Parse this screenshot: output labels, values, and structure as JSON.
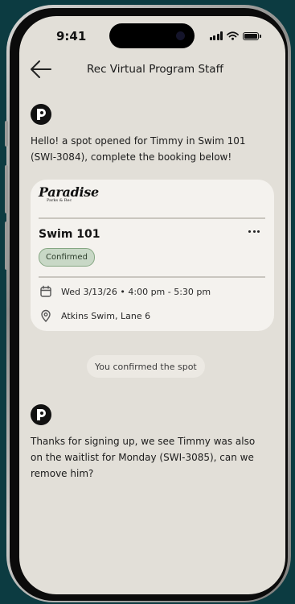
{
  "status_bar": {
    "time": "9:41"
  },
  "header": {
    "title": "Rec Virtual Program Staff"
  },
  "messages": [
    {
      "text": "Hello! a spot opened for Timmy in Swim 101 (SWI-3084), complete the booking below!"
    },
    {
      "text": "Thanks for signing up, we see Timmy was also on the waitlist for Monday (SWI-3085), can we remove him?"
    }
  ],
  "booking_card": {
    "logo_main": "Paradise",
    "logo_sub": "Parks & Rec",
    "title": "Swim 101",
    "status": "Confirmed",
    "datetime": "Wed 3/13/26 • 4:00 pm - 5:30 pm",
    "location": "Atkins Swim, Lane 6"
  },
  "confirmation": {
    "label": "You confirmed the spot"
  },
  "icons": {
    "back": "arrow-left-icon",
    "more": "more-horizontal-icon",
    "calendar": "calendar-icon",
    "location": "map-pin-icon",
    "avatar": "sender-logo-icon"
  },
  "colors": {
    "background": "#0c3b41",
    "screen": "#e2dfd8",
    "card": "#f4f2ee",
    "badge_bg": "#c8d8c6",
    "badge_border": "#86a783"
  }
}
